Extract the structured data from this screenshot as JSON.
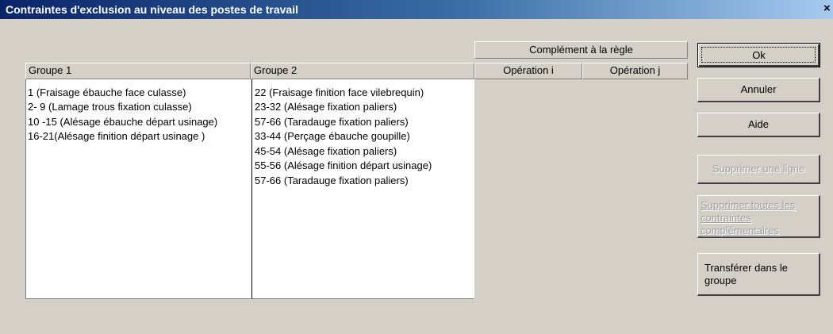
{
  "window": {
    "title": "Contraintes d'exclusion au niveau des postes de travail",
    "close_label": "×"
  },
  "table": {
    "complement_header": "Complément à la règle",
    "columns": {
      "groupe1": "Groupe 1",
      "groupe2": "Groupe 2",
      "operation_i": "Opération i",
      "operation_j": "Opération j"
    },
    "groupe1_items": [
      "1 (Fraisage ébauche face culasse)",
      "2- 9 (Lamage trous fixation culasse)",
      "10 -15 (Alésage ébauche départ usinage)",
      "16-21(Alésage finition départ usinage )"
    ],
    "groupe2_items": [
      "22 (Fraisage finition face vilebrequin)",
      "23-32 (Alésage fixation paliers)",
      "57-66 (Taradauge fixation paliers)",
      "33-44 (Perçage ébauche goupille)",
      "45-54 (Alésage fixation paliers)",
      "55-56 (Alésage finition départ usinage)",
      "57-66 (Taradauge fixation paliers)"
    ]
  },
  "buttons": {
    "ok": "Ok",
    "annuler": "Annuler",
    "aide": "Aide",
    "supprimer_ligne": "Supprimer une ligne",
    "supprimer_toutes": "Supprimer toutes les contraintes complémentaires",
    "transferer": "Transférer dans le groupe"
  }
}
